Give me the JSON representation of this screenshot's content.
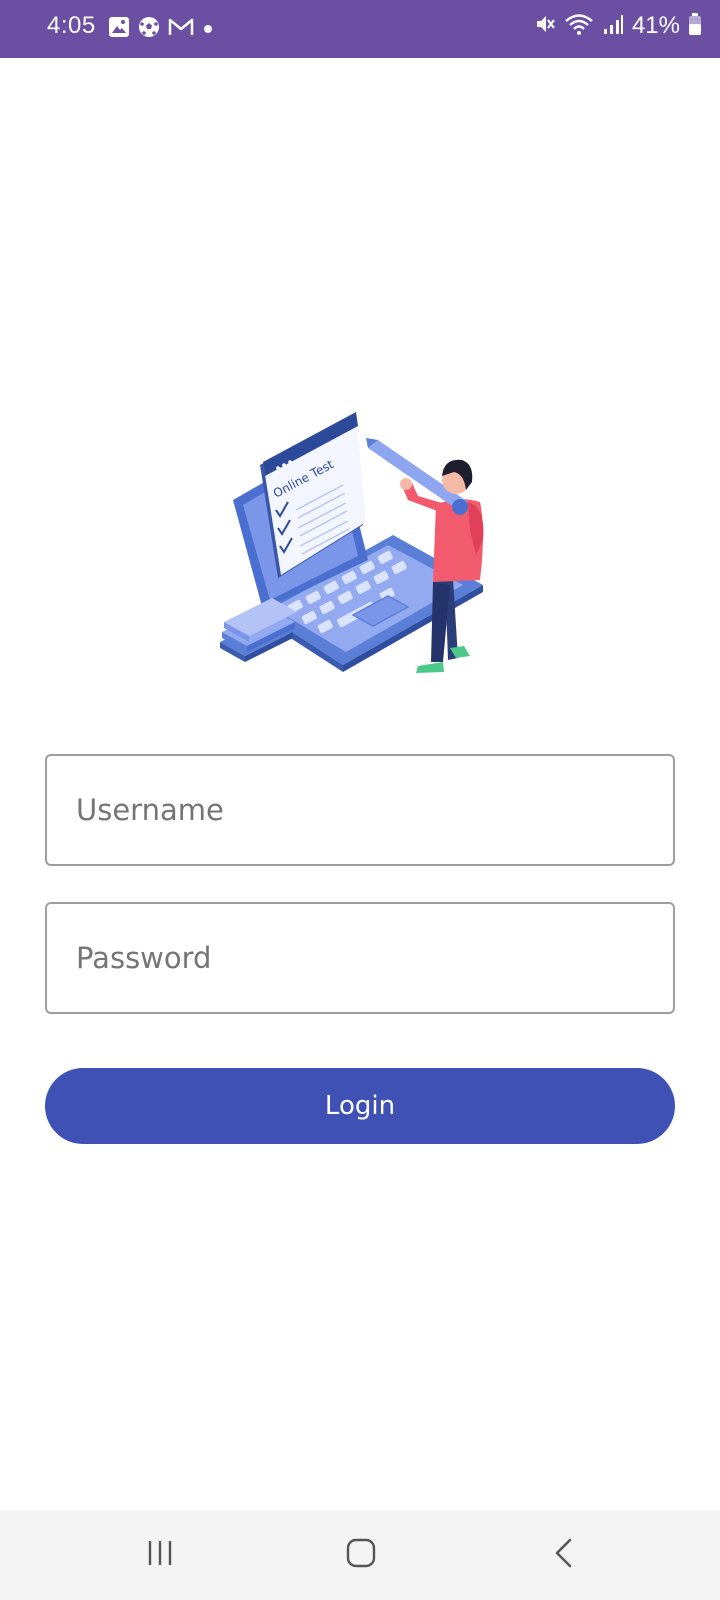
{
  "status_bar": {
    "time": "4:05",
    "battery": "41%",
    "background": "#6a4fa3",
    "left_icons": [
      "gallery-icon",
      "soccer-ball-icon",
      "gmail-icon",
      "dot-icon"
    ],
    "right_icons": [
      "mute-icon",
      "wifi-icon",
      "signal-icon",
      "battery-icon"
    ]
  },
  "illustration": {
    "screen_text": "Online Test"
  },
  "form": {
    "username_placeholder": "Username",
    "password_placeholder": "Password",
    "login_label": "Login"
  },
  "colors": {
    "accent": "#3f51b5",
    "field_border": "#9e9e9e"
  },
  "nav_bar": {
    "buttons": [
      "recents-icon",
      "home-icon",
      "back-icon"
    ]
  }
}
